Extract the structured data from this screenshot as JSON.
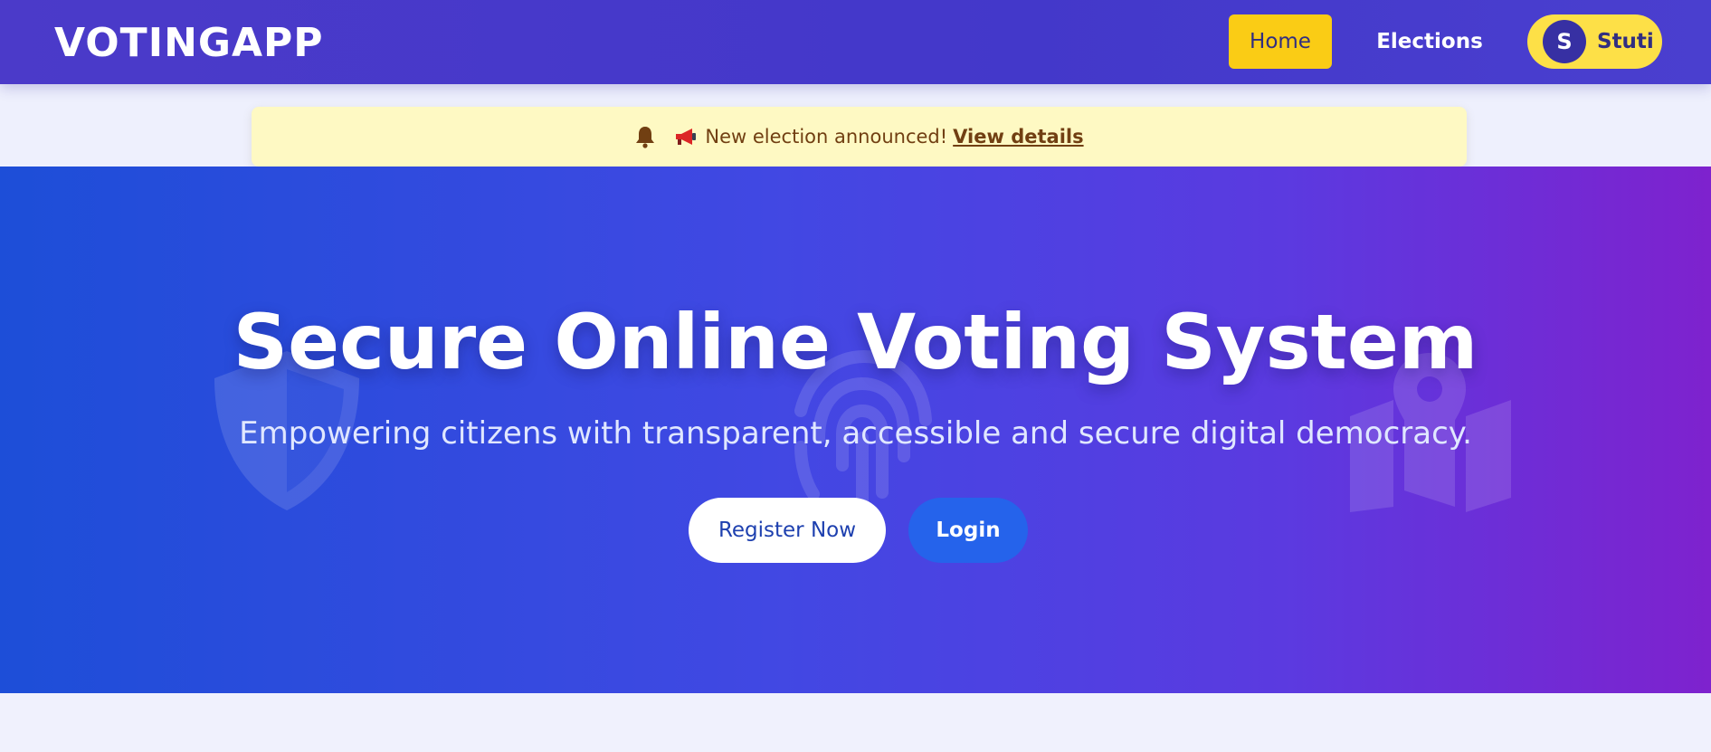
{
  "navbar": {
    "brand": "VOTINGAPP",
    "home_label": "Home",
    "elections_label": "Elections",
    "user": {
      "initial": "S",
      "name": "Stuti"
    }
  },
  "notice": {
    "bell_icon": "bell-icon",
    "megaphone_icon": "megaphone-icon",
    "message": "New election announced!",
    "link_label": "View details"
  },
  "hero": {
    "title": "Secure Online Voting System",
    "subtitle": "Empowering citizens with transparent, accessible and secure digital democracy.",
    "register_label": "Register Now",
    "login_label": "Login",
    "decor_icons": [
      "shield-icon",
      "fingerprint-icon",
      "map-pin-icon"
    ]
  },
  "colors": {
    "navbar": "#4338ca",
    "accent_yellow": "#facc15",
    "notice_bg": "#fef9c3",
    "hero_start": "#1d4ed8",
    "hero_end": "#7e22ce",
    "login_button": "#2563eb"
  }
}
